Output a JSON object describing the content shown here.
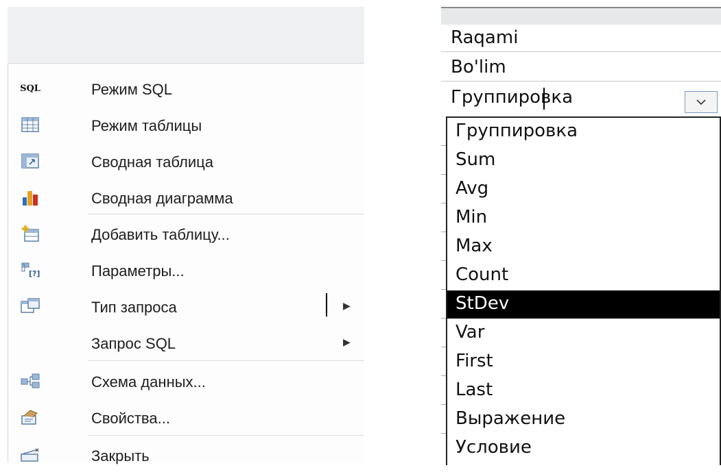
{
  "context_menu": {
    "items": [
      {
        "label": "Режим SQL",
        "icon": "sql-text-icon",
        "icon_text": "SQL",
        "has_submenu": false
      },
      {
        "label": "Режим таблицы",
        "icon": "datasheet-icon",
        "has_submenu": false
      },
      {
        "label": "Сводная таблица",
        "icon": "pivot-table-icon",
        "has_submenu": false
      },
      {
        "label": "Сводная диаграмма",
        "icon": "pivot-chart-icon",
        "has_submenu": false
      },
      {
        "label": "Добавить таблицу...",
        "icon": "add-table-icon",
        "has_submenu": false
      },
      {
        "label": "Параметры...",
        "icon": "parameters-icon",
        "has_submenu": false
      },
      {
        "label": "Тип запроса",
        "icon": "query-type-icon",
        "has_submenu": true
      },
      {
        "label": "Запрос SQL",
        "icon": null,
        "has_submenu": true
      },
      {
        "label": "Схема данных...",
        "icon": "relationships-icon",
        "has_submenu": false
      },
      {
        "label": "Свойства...",
        "icon": "properties-icon",
        "has_submenu": false
      },
      {
        "label": "Закрыть",
        "icon": "close-icon",
        "has_submenu": false
      }
    ],
    "submenu_arrow": "▶"
  },
  "query_grid": {
    "rows": [
      {
        "value": "Raqami"
      },
      {
        "value": "Bo'lim"
      },
      {
        "value": "Группировка"
      }
    ],
    "dropdown": {
      "selected": "StDev",
      "options": [
        "Группировка",
        "Sum",
        "Avg",
        "Min",
        "Max",
        "Count",
        "StDev",
        "Var",
        "First",
        "Last",
        "Выражение",
        "Условие"
      ]
    }
  },
  "colors": {
    "menu_bg": "#fdfdfd",
    "selection_bg": "#000000",
    "selection_fg": "#ffffff"
  }
}
